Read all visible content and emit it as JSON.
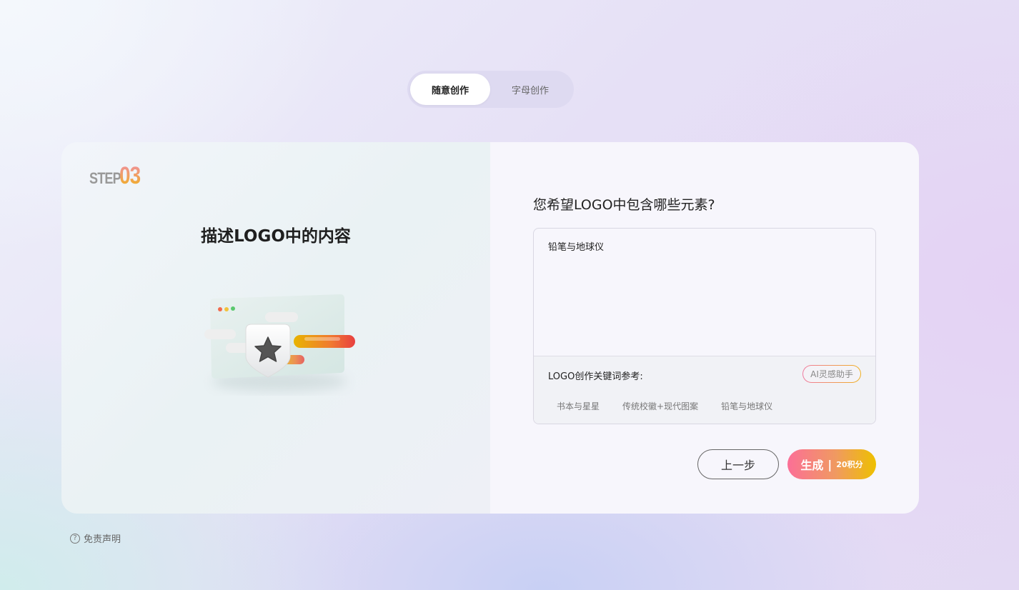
{
  "tabs": [
    {
      "label": "随意创作",
      "active": true
    },
    {
      "label": "字母创作",
      "active": false
    }
  ],
  "step": {
    "word": "STEP",
    "number": "03"
  },
  "left": {
    "title": "描述LOGO中的内容"
  },
  "right": {
    "question": "您希望LOGO中包含哪些元素?",
    "input_value": "铅笔与地球仪",
    "keyword_label": "LOGO创作关键词参考:",
    "assistant_label": "AI灵感助手",
    "chips": [
      "书本与星星",
      "传统校徽+现代图案",
      "铅笔与地球仪"
    ]
  },
  "buttons": {
    "prev_label": "上一步",
    "generate_label": "生成",
    "generate_sep": "|",
    "generate_cost": "20积分"
  },
  "footer": {
    "disclaimer_label": "免责声明"
  },
  "colors": {
    "accent_start": "#fb6f97",
    "accent_end": "#eec000"
  }
}
